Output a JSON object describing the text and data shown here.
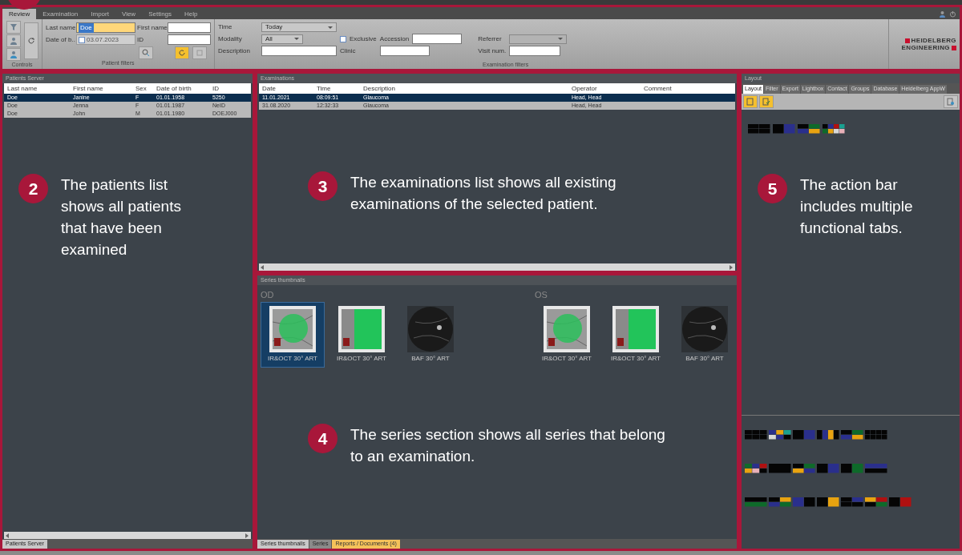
{
  "menu": [
    {
      "label": "Review",
      "selected": true
    },
    {
      "label": "Examination",
      "selected": false
    },
    {
      "label": "Import",
      "selected": false
    },
    {
      "label": "View",
      "selected": false
    },
    {
      "label": "Settings",
      "selected": false
    },
    {
      "label": "Help",
      "selected": false
    }
  ],
  "controls": {
    "title": "Controls"
  },
  "patient_filters": {
    "title": "Patient filters",
    "last_name": {
      "label": "Last name",
      "value": "Doe"
    },
    "first_name": {
      "label": "First name"
    },
    "date_of_birth": {
      "label": "Date of b..",
      "value": "03.07.2023",
      "checked": false
    },
    "id": {
      "label": "ID"
    }
  },
  "exam_filters": {
    "title": "Examination filters",
    "time": {
      "label": "Time",
      "value": "Today"
    },
    "modality": {
      "label": "Modality",
      "value": "All"
    },
    "exclusive": {
      "label": "Exclusive",
      "checked": false
    },
    "accession": {
      "label": "Accession"
    },
    "referrer": {
      "label": "Referrer",
      "disabled": true
    },
    "description": {
      "label": "Description"
    },
    "clinic": {
      "label": "Clinic"
    },
    "visit_num": {
      "label": "Visit num."
    }
  },
  "logo": [
    "HEIDELBERG",
    "ENGINEERING"
  ],
  "patients": {
    "title": "Patients Server",
    "columns": [
      "Last name",
      "First name",
      "Sex",
      "Date of birth",
      "ID"
    ],
    "rows": [
      {
        "cells": [
          "Doe",
          "Janine",
          "F",
          "01.01.1958",
          "5250"
        ],
        "selected": true
      },
      {
        "cells": [
          "Doe",
          "Jenna",
          "F",
          "01.01.1987",
          "NeID"
        ],
        "selected": false
      },
      {
        "cells": [
          "Doe",
          "John",
          "M",
          "01.01.1980",
          "DOEJ000"
        ],
        "selected": false
      }
    ],
    "tab": "Patients Server"
  },
  "examinations": {
    "title": "Examinations",
    "columns": [
      "Date",
      "Time",
      "Description",
      "Operator",
      "Comment"
    ],
    "rows": [
      {
        "cells": [
          "11.01.2021",
          "08:09:51",
          "Glaucoma",
          "Head, Head",
          ""
        ],
        "selected": true
      },
      {
        "cells": [
          "31.08.2020",
          "12:32:33",
          "Glaucoma",
          "Head, Head",
          ""
        ],
        "selected": false
      }
    ]
  },
  "series": {
    "title": "Series thumbnails",
    "groups": [
      {
        "eye": "OD",
        "items": [
          {
            "label": "IR&OCT 30° ART",
            "kind": "ir",
            "selected": true
          },
          {
            "label": "IR&OCT 30° ART",
            "kind": "oct",
            "selected": false
          },
          {
            "label": "BAF 30° ART",
            "kind": "baf",
            "selected": false
          }
        ]
      },
      {
        "eye": "OS",
        "items": [
          {
            "label": "IR&OCT 30° ART",
            "kind": "ir",
            "selected": false
          },
          {
            "label": "IR&OCT 30° ART",
            "kind": "oct",
            "selected": false
          },
          {
            "label": "BAF 30° ART",
            "kind": "baf",
            "selected": false
          }
        ]
      }
    ],
    "tabs": [
      {
        "label": "Series thumbnails",
        "selected": true,
        "highlighted": false
      },
      {
        "label": "Series",
        "selected": false,
        "highlighted": false
      },
      {
        "label": "Reports / Documents (4)",
        "selected": false,
        "highlighted": true
      }
    ]
  },
  "layout": {
    "title": "Layout",
    "tabs": [
      {
        "label": "Layout",
        "selected": true
      },
      {
        "label": "Filter",
        "selected": false
      },
      {
        "label": "Export",
        "selected": false
      },
      {
        "label": "Lightbox",
        "selected": false
      },
      {
        "label": "Contact",
        "selected": false
      },
      {
        "label": "Groups",
        "selected": false
      },
      {
        "label": "Database",
        "selected": false
      },
      {
        "label": "Heidelberg AppW",
        "selected": false
      }
    ]
  },
  "callouts": [
    {
      "number": "2",
      "text": "The patients list shows all patients that have been examined"
    },
    {
      "number": "3",
      "text": "The examinations list shows all existing examinations of the selected patient."
    },
    {
      "number": "4",
      "text": "The series section shows all series that belong to an examination."
    },
    {
      "number": "5",
      "text": "The action bar includes multiple functional tabs."
    }
  ]
}
